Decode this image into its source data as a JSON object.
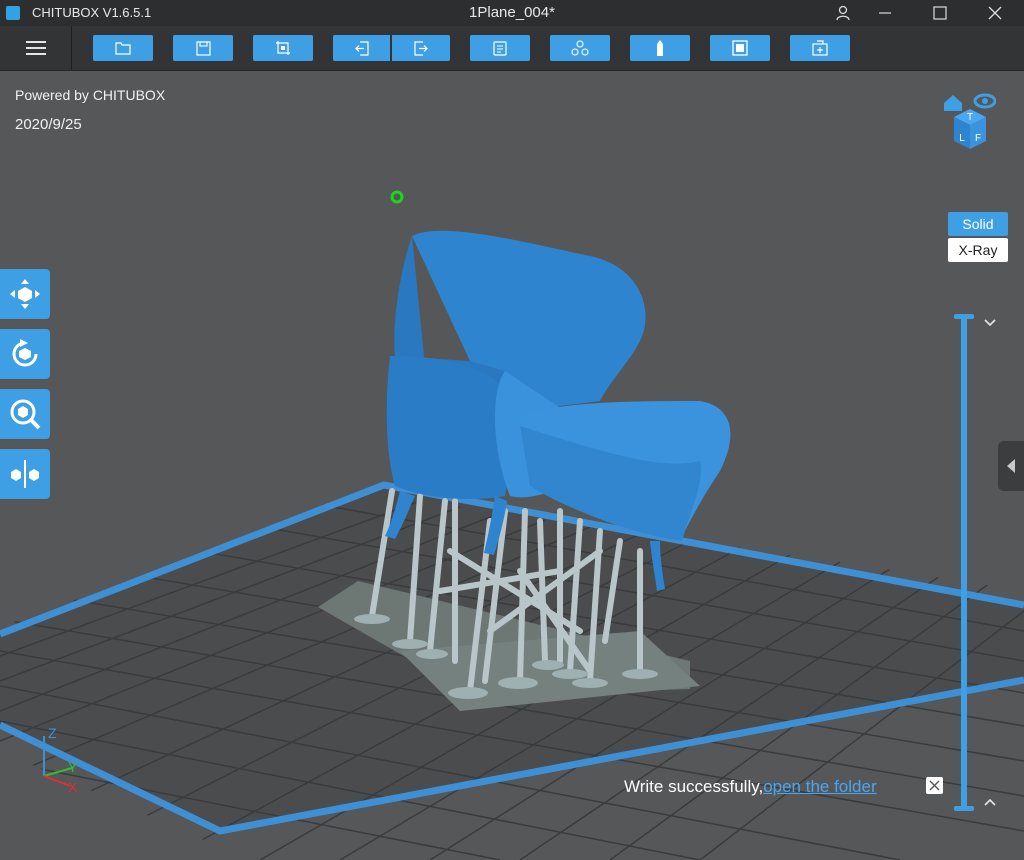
{
  "app": {
    "name": "CHITUBOX V1.6.5.1",
    "document_title": "1Plane_004*"
  },
  "toolbar": {
    "buttons": [
      {
        "name": "open-file",
        "icon": "open-folder-icon"
      },
      {
        "name": "save",
        "icon": "save-icon"
      },
      {
        "name": "screenshot",
        "icon": "screenshot-icon"
      },
      {
        "name": "import",
        "icon": "import-icon"
      },
      {
        "name": "export",
        "icon": "export-icon"
      },
      {
        "name": "clipboard",
        "icon": "clipboard-icon"
      },
      {
        "name": "multi-model",
        "icon": "multi-model-icon"
      },
      {
        "name": "single",
        "icon": "single-model-icon"
      },
      {
        "name": "view",
        "icon": "view-icon"
      },
      {
        "name": "add",
        "icon": "add-icon"
      }
    ]
  },
  "viewport": {
    "powered_by": "Powered by CHITUBOX",
    "date": "2020/9/25",
    "view_modes": {
      "solid": "Solid",
      "xray": "X-Ray",
      "active": "Solid"
    },
    "view_cube_letters": [
      "T",
      "L",
      "F"
    ],
    "axes": {
      "x": "X",
      "y": "Y",
      "z": "Z"
    }
  },
  "left_tools": [
    {
      "name": "move",
      "icon": "move-icon"
    },
    {
      "name": "rotate",
      "icon": "rotate-icon"
    },
    {
      "name": "scale",
      "icon": "scale-icon"
    },
    {
      "name": "mirror",
      "icon": "mirror-icon"
    }
  ],
  "notification": {
    "message": "Write successfully,",
    "link": "open the folder"
  },
  "colors": {
    "accent": "#3f9fe5",
    "background": "#555759",
    "titlebar": "#2d2e30",
    "model": "#2f84cf",
    "supports": "#b8c6c9"
  }
}
